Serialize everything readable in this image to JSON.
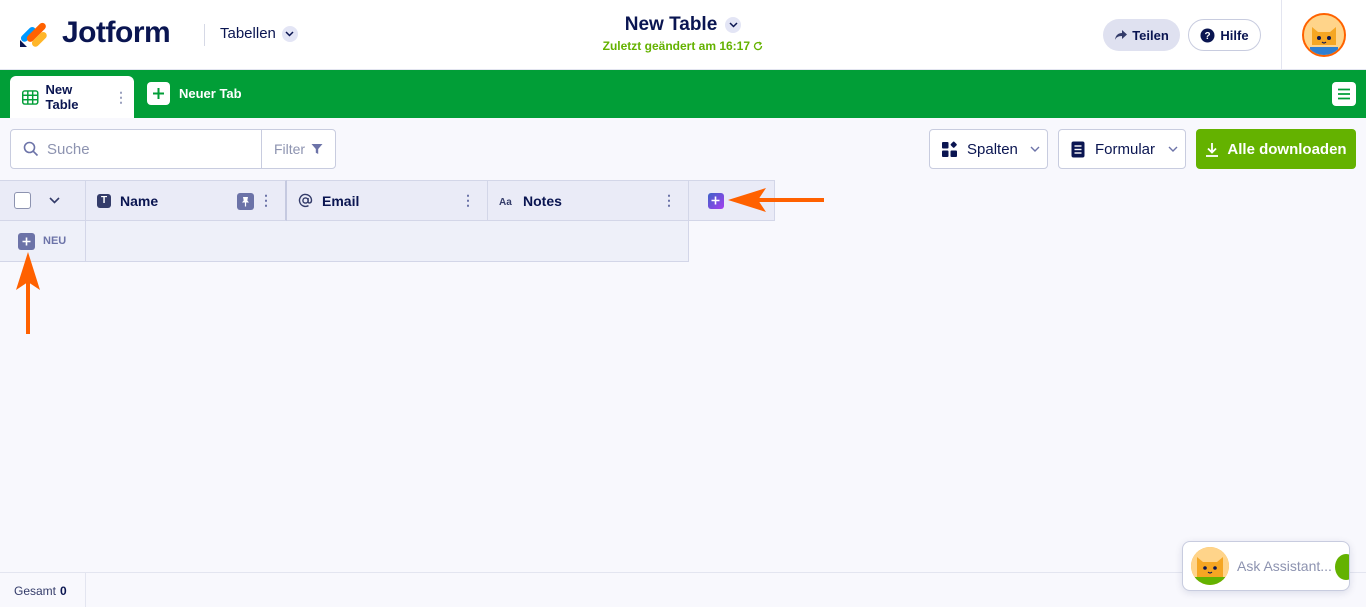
{
  "header": {
    "brand": "Jotform",
    "section_label": "Tabellen",
    "title": "New Table",
    "subtitle": "Zuletzt geändert am 16:17",
    "share_label": "Teilen",
    "help_label": "Hilfe"
  },
  "tabs": {
    "items": [
      {
        "label": "New Table",
        "active": true
      }
    ],
    "new_tab_label": "Neuer Tab"
  },
  "toolbar": {
    "search_placeholder": "Suche",
    "search_value": "",
    "filter_label": "Filter",
    "columns_label": "Spalten",
    "form_label": "Formular",
    "download_label": "Alle downloaden"
  },
  "table": {
    "columns": [
      {
        "label": "Name",
        "type_icon": "text-type-icon"
      },
      {
        "label": "Email",
        "type_icon": "at-icon"
      },
      {
        "label": "Notes",
        "type_icon": "long-text-icon"
      }
    ],
    "new_row_label": "NEU"
  },
  "footer": {
    "total_label": "Gesamt",
    "total_value": "0"
  },
  "assistant": {
    "label": "Ask Assistant..."
  },
  "colors": {
    "tab_bar": "#019e37",
    "download_button": "#64b200",
    "annotation_arrow": "#ff6100",
    "navy": "#0a1551"
  }
}
